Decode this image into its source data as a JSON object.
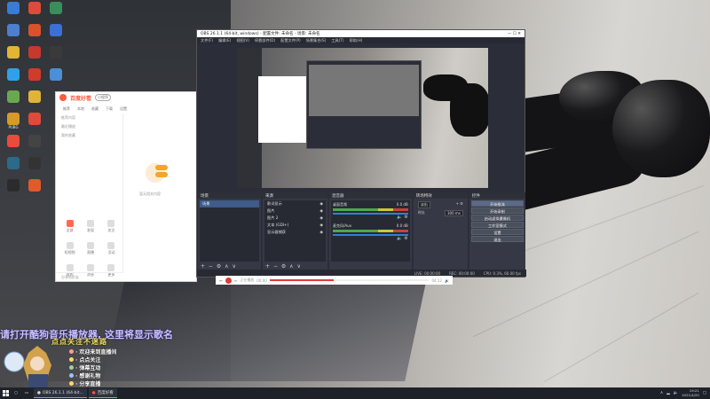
{
  "wallpaper": {
    "palette": [
      "#3a3a3c",
      "#8a8886",
      "#d8d6d2"
    ]
  },
  "desktop_icons": [
    {
      "label": "",
      "color": "#3a7bd5"
    },
    {
      "label": "",
      "color": "#e04a3a"
    },
    {
      "label": "",
      "color": "#3a8e5c"
    },
    {
      "label": "",
      "color": "#4c7fd0"
    },
    {
      "label": "",
      "color": "#d9522c"
    },
    {
      "label": "",
      "color": "#3b70d5"
    },
    {
      "label": "",
      "color": "#e2b633"
    },
    {
      "label": "",
      "color": "#c7382e"
    },
    {
      "label": "",
      "color": "#3a3a3a"
    },
    {
      "label": "",
      "color": "#2ea1e8"
    },
    {
      "label": "",
      "color": "#d13b2b"
    },
    {
      "label": "",
      "color": "#4b8fd6"
    },
    {
      "label": "",
      "color": "#6aa84f"
    },
    {
      "label": "",
      "color": "#e0b43a"
    },
    {
      "label": "",
      "color": "#eb6b2e"
    },
    {
      "label": "PUBG",
      "color": "#d59a2a"
    },
    {
      "label": "",
      "color": "#e04a3a"
    },
    {
      "label": "",
      "color": "#3a7bd5"
    },
    {
      "label": "",
      "color": "#e74c3c"
    },
    {
      "label": "",
      "color": "#444"
    },
    {
      "label": "",
      "color": "#6a3ad5"
    },
    {
      "label": "",
      "color": "#2b6a8a"
    },
    {
      "label": "",
      "color": "#333"
    },
    {
      "label": "",
      "color": "#3a7bd5"
    },
    {
      "label": "",
      "color": "#2b2b2b"
    },
    {
      "label": "",
      "color": "#e05a2a"
    }
  ],
  "app_window": {
    "title": "百度好看",
    "badge": "小程序",
    "tabs": [
      "推荐",
      "本地",
      "收藏",
      "下载",
      "设置"
    ],
    "side_rows": [
      "推荐内容",
      "最近播放",
      "我的收藏"
    ],
    "grid_labels": [
      "全部",
      "发现",
      "关注",
      "短视频",
      "直播",
      "活动",
      "我的",
      "消息",
      "更多"
    ],
    "bottom": "分享给好友",
    "main_text": "暂无相关内容",
    "illus_labels": [
      "全部",
      "发现"
    ]
  },
  "obs": {
    "title": "OBS 26.1.1 (64-bit, windows) - 配置文件: 未命名 - 场景: 未命名",
    "menu": [
      "文件(F)",
      "编辑(E)",
      "视图(V)",
      "停靠部件(D)",
      "配置文件(P)",
      "场景集合(S)",
      "工具(T)",
      "帮助(H)"
    ],
    "panels": {
      "scenes": {
        "title": "场景",
        "items": [
          "场景"
        ]
      },
      "sources": {
        "title": "来源",
        "items": [
          "歌词显示",
          "图片",
          "图片 2",
          "文本 (GDI+)",
          "显示器捕获"
        ]
      },
      "mixer": {
        "title": "混音器",
        "channels": [
          {
            "name": "桌面音频",
            "db": "0.0 dB"
          },
          {
            "name": "麦克风/Aux",
            "db": "0.0 dB"
          }
        ]
      },
      "transitions": {
        "title": "转场特效",
        "type": "淡出",
        "duration_label": "时长",
        "duration": "300 ms"
      },
      "controls": {
        "title": "控件",
        "buttons": [
          "开始推流",
          "开始录制",
          "启动虚拟摄像机",
          "工作室模式",
          "设置",
          "退出"
        ]
      }
    },
    "status": [
      "LIVE: 00:00:00",
      "REC: 00:00:00",
      "CPU: 0.3%, 60.00 fps"
    ],
    "footer_glyphs": "+ − ⚙ ∧ ∨"
  },
  "player": {
    "time_left": "00:00",
    "time_right": "04:12",
    "title": "正在播放"
  },
  "overlay": {
    "lyric": "请打开酷狗音乐播放器, 这里将显示歌名",
    "chars": "点点关注不迷路",
    "chat": [
      {
        "text": "· 欢迎来到直播间",
        "color": "#ff9b9b"
      },
      {
        "text": "· 点点关注",
        "color": "#ffd966"
      },
      {
        "text": "· 弹幕互动",
        "color": "#9bd39b"
      },
      {
        "text": "· 感谢礼物",
        "color": "#9bc2ff"
      },
      {
        "text": "· 分享直播",
        "color": "#ffd966"
      }
    ]
  },
  "taskbar": {
    "items": [
      "OBS 26.1.1 (64-bit...",
      "百度好看"
    ],
    "time": "19:21",
    "date": "2021/4/20"
  }
}
